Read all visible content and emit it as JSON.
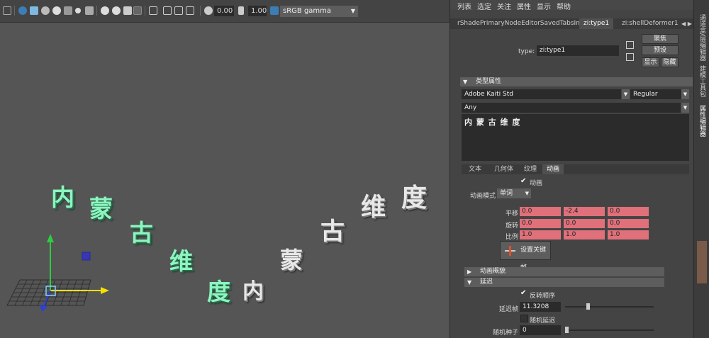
{
  "viewport": {
    "toolbar": {
      "exposure": "0.00",
      "gamma": "1.00",
      "color_space": "sRGB gamma"
    },
    "text_green": [
      "内",
      "蒙",
      "古",
      "维",
      "度"
    ],
    "text_white": [
      "内",
      "蒙",
      "古",
      "维",
      "度"
    ]
  },
  "menu": [
    "列表",
    "选定",
    "关注",
    "属性",
    "显示",
    "帮助"
  ],
  "tabs": [
    {
      "label": "rShadePrimaryNodeEditorSavedTabsInfo"
    },
    {
      "label": "zi:type1"
    },
    {
      "label": "zi:shellDeformer1"
    }
  ],
  "node": {
    "type_label": "type:",
    "type_value": "zi:type1",
    "focus_btn": "聚焦",
    "preset_btn": "预设",
    "show_btn": "显示",
    "hide_btn": "隐藏"
  },
  "type_attrs": {
    "section": "类型属性",
    "font": "Adobe Kaiti Std",
    "style": "Regular",
    "writing_system": "Any",
    "text": "内 蒙 古 维 度"
  },
  "subtabs": [
    "文本",
    "几何体",
    "纹理",
    "动画"
  ],
  "animation": {
    "enable_label": "动画",
    "mode_label": "动画模式",
    "mode_value": "单词",
    "translate_label": "平移",
    "translate": [
      "0.0",
      "-2.4",
      "0.0"
    ],
    "rotate_label": "旋转",
    "rotate": [
      "0.0",
      "0.0",
      "0.0"
    ],
    "scale_label": "比例",
    "scale": [
      "1.0",
      "1.0",
      "1.0"
    ],
    "keyframe_btn": "设置关键帧"
  },
  "sections": {
    "overview": "动画概貌",
    "delay": "延迟"
  },
  "delay": {
    "reverse_label": "反转顺序",
    "frames_label": "延迟帧",
    "frames_value": "11.3208",
    "random_label": "随机延迟",
    "seed_label": "随机种子",
    "seed_value": "0",
    "frames_fraction": 0.25,
    "seed_fraction": 0.0
  },
  "side_tabs": [
    "通道盒/层编辑器",
    "建模工具包",
    "属性编辑器"
  ],
  "colors": {
    "green_text": "#8cf5c0",
    "pink_field": "#e0707a",
    "axis_y": "#2ecc40",
    "axis_x": "#f5e000",
    "axis_z": "#2f3fd8"
  }
}
